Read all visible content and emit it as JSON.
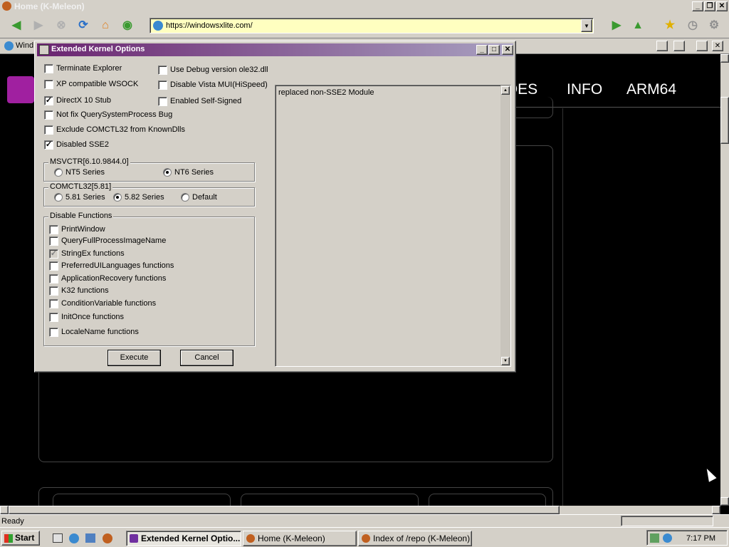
{
  "browser": {
    "title": "Home (K-Meleon)",
    "url": "https://windowsxlite.com/",
    "tab_label": "Wind",
    "status": "Ready"
  },
  "site_nav": [
    "DES",
    "INFO",
    "ARM64"
  ],
  "dialog": {
    "title": "Extended Kernel Options",
    "left_checks": [
      {
        "label": "Terminate Explorer",
        "checked": false
      },
      {
        "label": "XP compatible WSOCK",
        "checked": false
      },
      {
        "label": "DirectX 10 Stub",
        "checked": true
      },
      {
        "label": "Not fix QuerySystemProcess Bug",
        "checked": false
      },
      {
        "label": "Exclude COMCTL32 from KnownDlls",
        "checked": false
      },
      {
        "label": "Disabled SSE2",
        "checked": true
      }
    ],
    "right_checks": [
      {
        "label": "Use Debug version ole32.dll",
        "checked": false
      },
      {
        "label": "Disable Vista MUI(HiSpeed)",
        "checked": false
      },
      {
        "label": "Enabled Self-Signed",
        "checked": false
      }
    ],
    "msvctr": {
      "legend": "MSVCTR[6.10.9844.0]",
      "options": [
        {
          "label": "NT5 Series",
          "selected": false
        },
        {
          "label": "NT6 Series",
          "selected": true
        }
      ]
    },
    "comctl32": {
      "legend": "COMCTL32[5.81]",
      "options": [
        {
          "label": "5.81 Series",
          "selected": false
        },
        {
          "label": "5.82 Series",
          "selected": true
        },
        {
          "label": "Default",
          "selected": false
        }
      ]
    },
    "disable_functions": {
      "legend": "Disable Functions",
      "items": [
        {
          "label": "PrintWindow",
          "checked": false,
          "grey": false
        },
        {
          "label": "QueryFullProcessImageName",
          "checked": false,
          "grey": false
        },
        {
          "label": "StringEx functions",
          "checked": true,
          "grey": true
        },
        {
          "label": "PreferredUILanguages functions",
          "checked": false,
          "grey": false
        },
        {
          "label": "ApplicationRecovery functions",
          "checked": false,
          "grey": false
        },
        {
          "label": "K32 functions",
          "checked": false,
          "grey": false
        },
        {
          "label": "ConditionVariable functions",
          "checked": false,
          "grey": false
        },
        {
          "label": "InitOnce functions",
          "checked": false,
          "grey": false
        },
        {
          "label": "LocaleName functions",
          "checked": false,
          "grey": false
        }
      ]
    },
    "textbox": "replaced non-SSE2 Module",
    "execute_label": "Execute",
    "cancel_label": "Cancel"
  },
  "taskbar": {
    "start_label": "Start",
    "tasks": [
      "Extended Kernel Optio...",
      "Home (K-Meleon)",
      "Index of /repo (K-Meleon)"
    ],
    "clock": "7:17 PM"
  },
  "colors": {
    "dialog_title_start": "#6a2470",
    "window_face": "#d4d0c8",
    "url_bg": "#ffffc0"
  }
}
